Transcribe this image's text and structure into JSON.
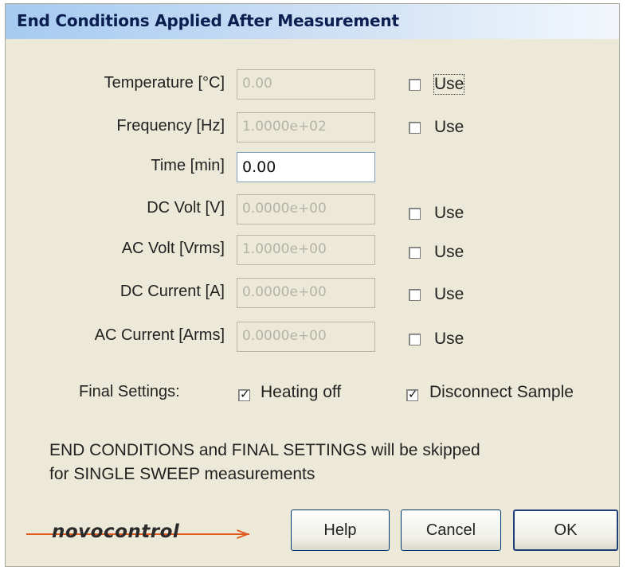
{
  "window": {
    "title": "End Conditions Applied After Measurement"
  },
  "conditions": [
    {
      "label": "Temperature [°C]",
      "value": "0.00",
      "enabled": false,
      "has_use": true,
      "use_label": "Use",
      "use_checked": false,
      "use_focused": true
    },
    {
      "label": "Frequency [Hz]",
      "value": "1.0000e+02",
      "enabled": false,
      "has_use": true,
      "use_label": "Use",
      "use_checked": false
    },
    {
      "label": "Time [min]",
      "value": "0.00",
      "enabled": true,
      "has_use": false
    },
    {
      "label": "DC Volt [V]",
      "value": "0.0000e+00",
      "enabled": false,
      "has_use": true,
      "use_label": "Use",
      "use_checked": false
    },
    {
      "label": "AC Volt [Vrms]",
      "value": "1.0000e+00",
      "enabled": false,
      "has_use": true,
      "use_label": "Use",
      "use_checked": false
    },
    {
      "label": "DC Current [A]",
      "value": "0.0000e+00",
      "enabled": false,
      "has_use": true,
      "use_label": "Use",
      "use_checked": false
    },
    {
      "label": "AC Current [Arms]",
      "value": "0.0000e+00",
      "enabled": false,
      "has_use": true,
      "use_label": "Use",
      "use_checked": false
    }
  ],
  "final_settings": {
    "label": "Final Settings:",
    "heating_off": {
      "label": "Heating off",
      "checked": true
    },
    "disconnect_sample": {
      "label": "Disconnect Sample",
      "checked": true
    }
  },
  "note": {
    "line1": "END CONDITIONS and FINAL SETTINGS will be skipped",
    "line2": "for SINGLE SWEEP measurements"
  },
  "logo": {
    "text": "novocontrol"
  },
  "buttons": {
    "help": "Help",
    "cancel": "Cancel",
    "ok": "OK"
  },
  "colors": {
    "logo_accent": "#e05a20",
    "title_text": "#0b1e50"
  }
}
